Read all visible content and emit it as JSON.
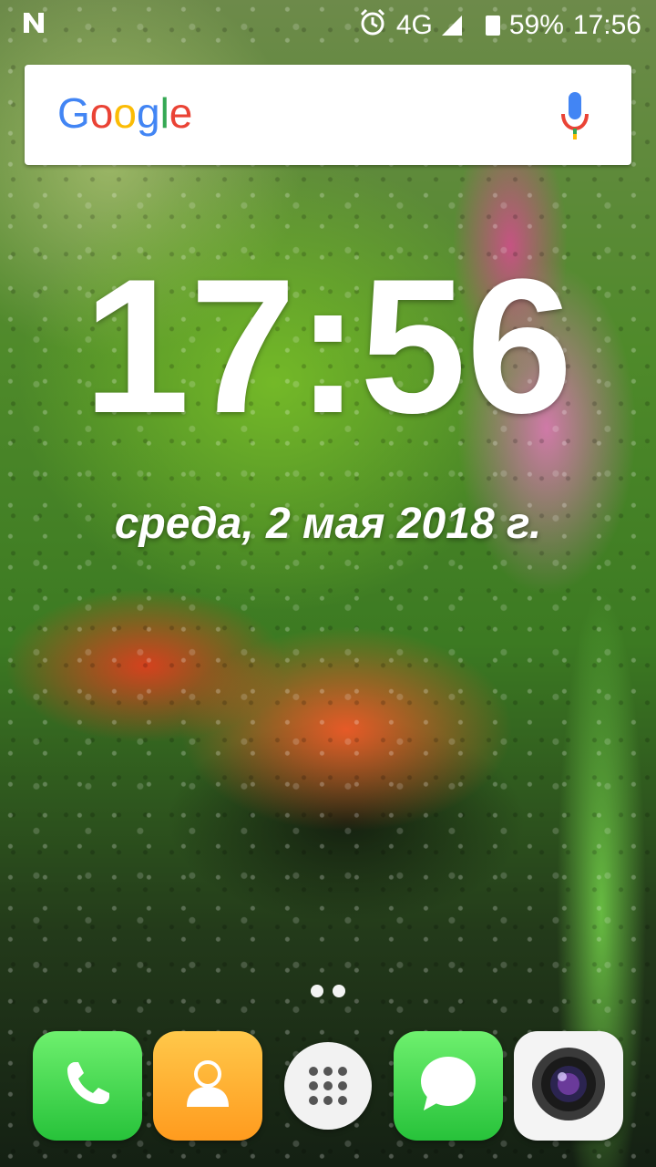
{
  "status_bar": {
    "notification_icon": "n-notification-icon",
    "alarm_icon": "alarm-clock-icon",
    "network": "4G",
    "battery_percent": "59%",
    "time": "17:56"
  },
  "search": {
    "logo_letters": [
      "G",
      "o",
      "o",
      "g",
      "l",
      "e"
    ],
    "mic_icon": "microphone-icon"
  },
  "clock_widget": {
    "time": "17:56",
    "date": "среда, 2 мая 2018 г."
  },
  "page_indicator": {
    "pages": 2
  },
  "dock": {
    "apps": [
      {
        "name": "Phone",
        "icon": "phone-icon"
      },
      {
        "name": "Contacts",
        "icon": "contact-icon"
      },
      {
        "name": "All apps",
        "icon": "app-drawer-icon"
      },
      {
        "name": "Messages",
        "icon": "chat-bubble-icon"
      },
      {
        "name": "Camera",
        "icon": "camera-lens-icon"
      }
    ]
  },
  "colors": {
    "google_blue": "#4285F4",
    "google_red": "#EA4335",
    "google_yellow": "#FBBC05",
    "google_green": "#34A853",
    "dock_green": "#27c23a",
    "dock_orange": "#ff9b1e"
  }
}
